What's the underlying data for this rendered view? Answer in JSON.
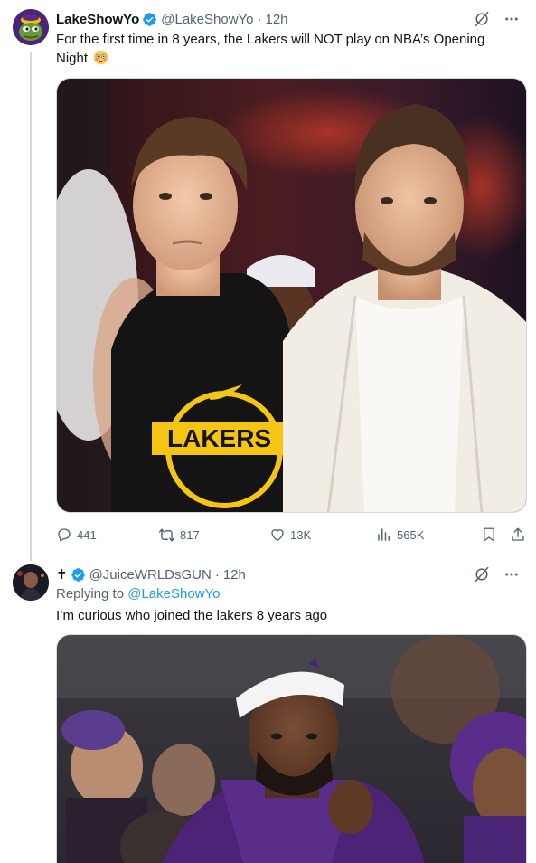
{
  "tweet1": {
    "author_name": "LakeShowYo",
    "handle": "@LakeShowYo",
    "separator": "·",
    "time": "12h",
    "text": "For the first time in 8 years, the Lakers will NOT play on NBA’s Opening Night",
    "emoji": "flushed-face",
    "media_alt": "Photo of two Lakers players courtside, one in a black Lakers hoodie and one in a white jacket",
    "stats": {
      "replies": "441",
      "reposts": "817",
      "likes": "13K",
      "views": "565K"
    }
  },
  "tweet2": {
    "author_name": "✝",
    "handle": "@JuiceWRLDsGUN",
    "separator": "·",
    "time": "12h",
    "replying_prefix": "Replying to ",
    "replying_to": "@LakeShowYo",
    "text": "I’m curious who joined the lakers 8 years ago",
    "media_alt": "Photo of a Lakers player wearing a white headband in the crowd"
  },
  "colors": {
    "verified": "#1d9bf0",
    "link": "#1d9bf0",
    "secondary_text": "#536471",
    "border": "#cfd9de"
  }
}
